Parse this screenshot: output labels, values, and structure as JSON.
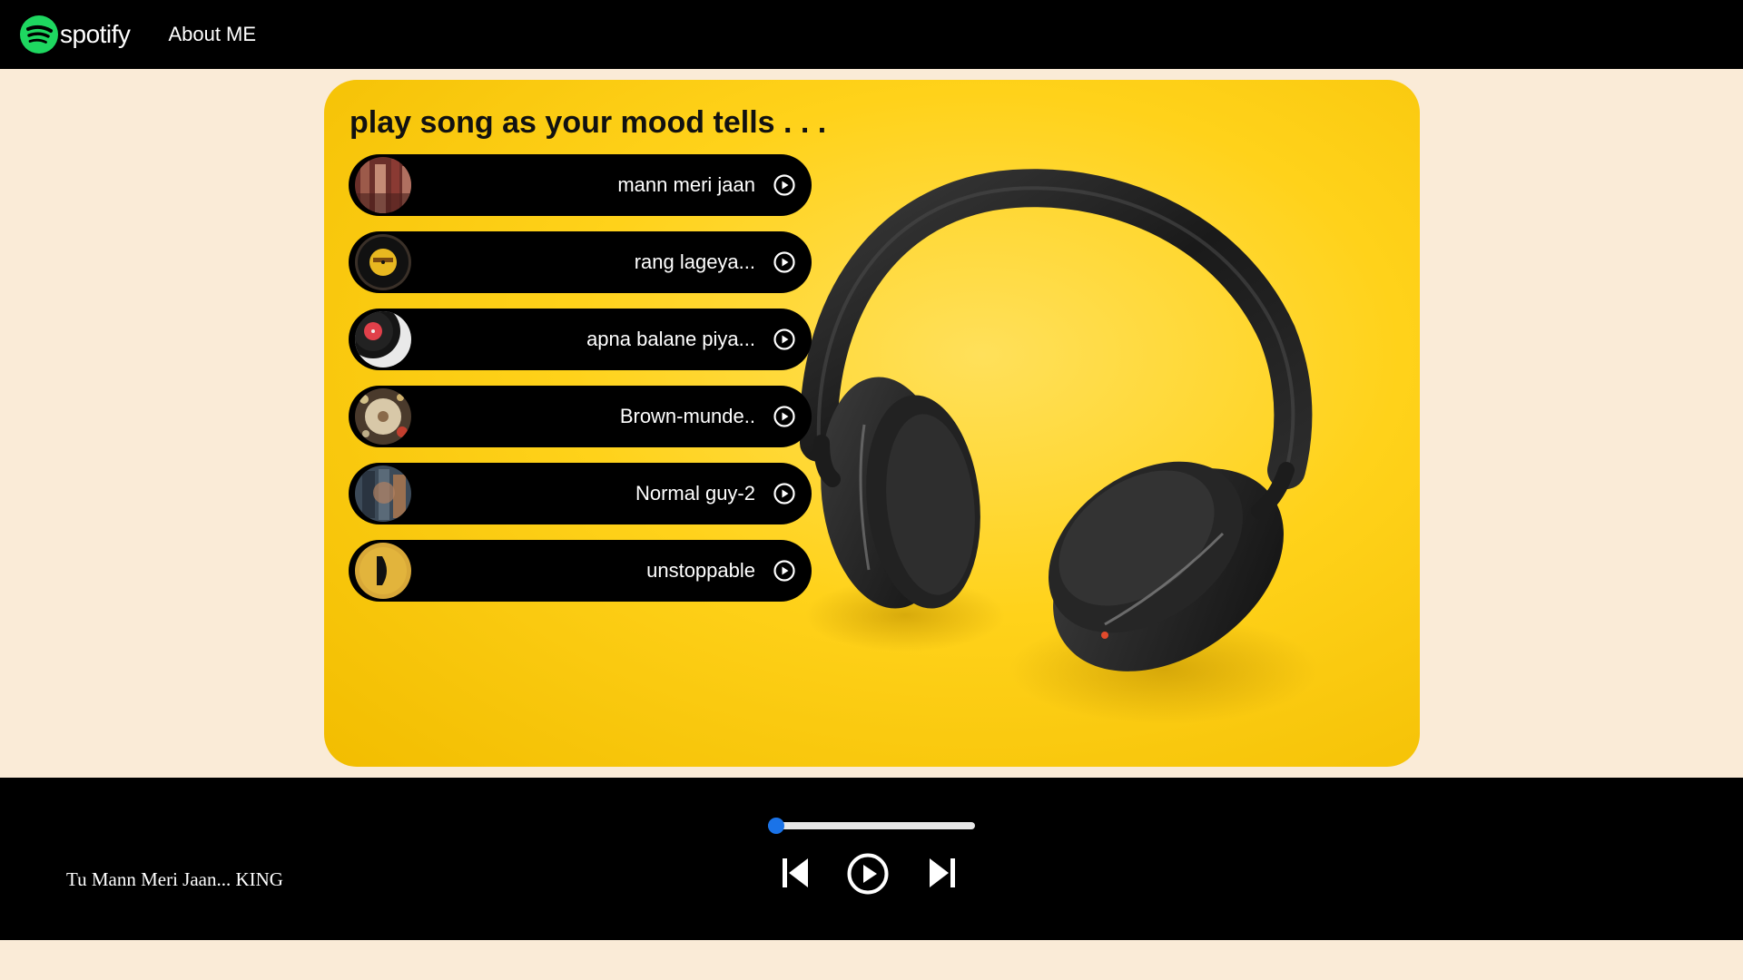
{
  "nav": {
    "brand": "spotify",
    "links": [
      "About ME"
    ],
    "brand_color": "#1ed760"
  },
  "main": {
    "title": "play song as your mood tells . . .",
    "songs": [
      {
        "name": "mann meri jaan",
        "thumb": "crowd-photo"
      },
      {
        "name": "rang lageya...",
        "thumb": "vinyl-label-yellow"
      },
      {
        "name": "apna balane piya...",
        "thumb": "vinyl-red-label"
      },
      {
        "name": "Brown-munde..",
        "thumb": "turntable-bokeh"
      },
      {
        "name": "Normal guy-2",
        "thumb": "record-stack"
      },
      {
        "name": "unstoppable",
        "thumb": "yellow-circle-logo"
      }
    ]
  },
  "player": {
    "now_playing": "Tu Mann Meri Jaan... KING",
    "progress": 0,
    "accent": "#1a73e8",
    "controls": [
      "previous-icon",
      "play-icon",
      "next-icon"
    ]
  }
}
